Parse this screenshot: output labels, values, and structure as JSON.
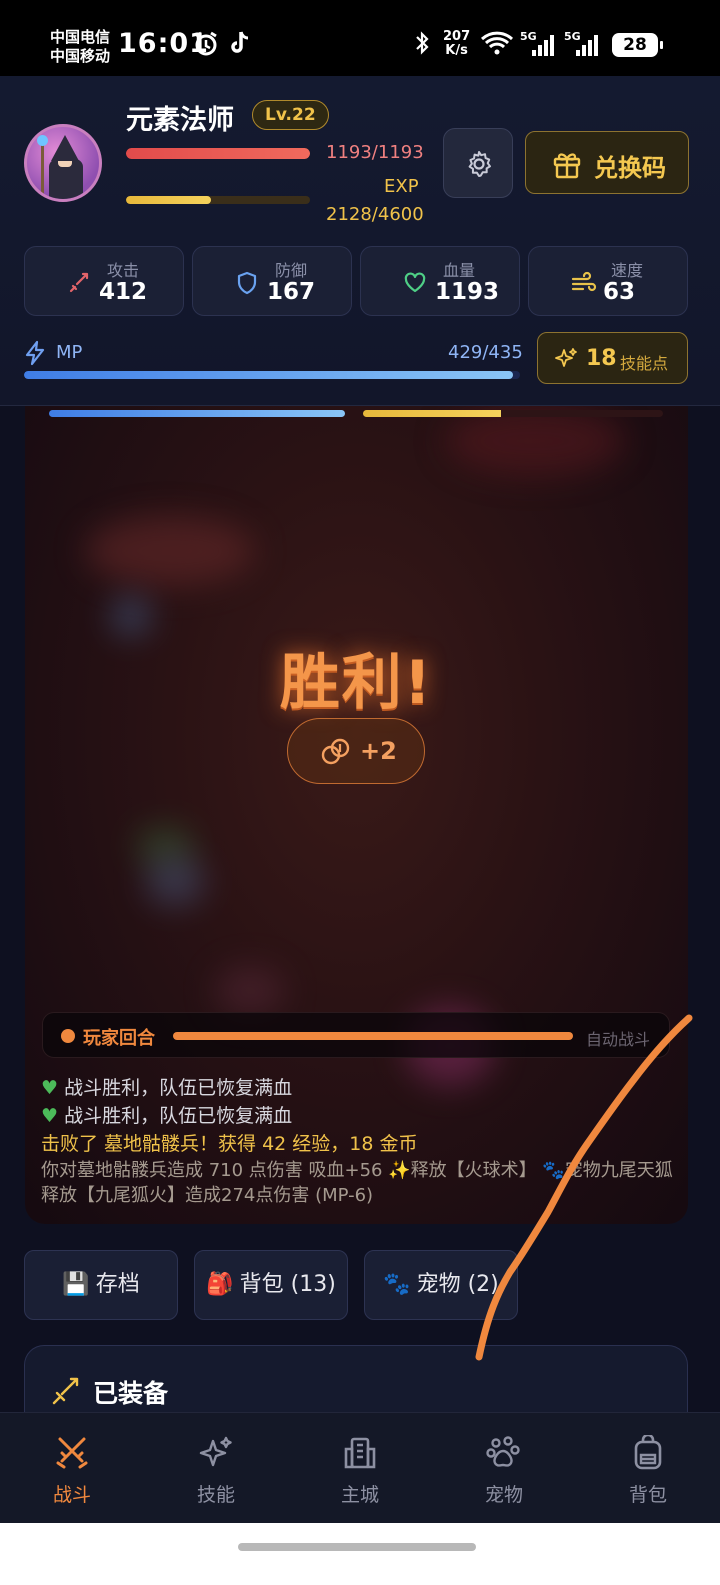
{
  "status_bar": {
    "carrier_1": "中国电信",
    "carrier_2": "中国移动",
    "time": "16:01",
    "net_speed_value": "207",
    "net_speed_unit": "K/s",
    "sim1_label": "5G",
    "sim2_label": "5G",
    "battery": "28"
  },
  "player": {
    "name": "元素法师",
    "level": "Lv.22",
    "hp_text": "1193/1193",
    "hp_ratio": 1.0,
    "exp_label": "EXP",
    "exp_text": "2128/4600",
    "exp_ratio": 0.4626,
    "avatar_icon": "wizard-avatar"
  },
  "buttons": {
    "settings_icon": "gear-icon",
    "redeem_label": "兑换码",
    "redeem_icon": "gift-icon"
  },
  "stats": [
    {
      "label": "攻击",
      "value": "412",
      "icon": "sword-icon",
      "color": "#e2646a"
    },
    {
      "label": "防御",
      "value": "167",
      "icon": "shield-icon",
      "color": "#6aa2f0"
    },
    {
      "label": "血量",
      "value": "1193",
      "icon": "heart-icon",
      "color": "#4fcf86"
    },
    {
      "label": "速度",
      "value": "63",
      "icon": "wind-icon",
      "color": "#e8c24a"
    }
  ],
  "mp": {
    "label": "MP",
    "text": "429/435",
    "ratio": 0.986
  },
  "skill_points": {
    "count": "18",
    "label": "技能点"
  },
  "battle": {
    "ally_mp_ratio": 1.0,
    "enemy_bar_ratio": 0.46,
    "victory_text": "胜利!",
    "reward_text": "+2",
    "reward_icon": "coins-icon",
    "turn_label": "玩家回合",
    "turn_progress": 1.0,
    "auto_label": "自动战斗"
  },
  "log": {
    "heal_1": "战斗胜利，队伍已恢复满血",
    "heal_2": "战斗胜利，队伍已恢复满血",
    "kill": "击败了 墓地骷髅兵！获得 42 经验，18 金币",
    "damage": "你对墓地骷髅兵造成 710 点伤害 吸血+56 ✨释放【火球术】 🐾宠物九尾天狐释放【九尾狐火】造成274点伤害 (MP-6)"
  },
  "actions": {
    "save_icon": "💾",
    "save_label": "存档",
    "bag_icon": "🎒",
    "bag_label": "背包 (13)",
    "pet_icon": "🐾",
    "pet_label": "宠物 (2)"
  },
  "equipment": {
    "title": "已装备",
    "icon": "sword-icon"
  },
  "nav": [
    {
      "label": "战斗",
      "icon": "crossed-swords-icon",
      "active": true
    },
    {
      "label": "技能",
      "icon": "sparkles-icon",
      "active": false
    },
    {
      "label": "主城",
      "icon": "building-icon",
      "active": false
    },
    {
      "label": "宠物",
      "icon": "paw-icon",
      "active": false
    },
    {
      "label": "背包",
      "icon": "backpack-icon",
      "active": false
    }
  ],
  "colors": {
    "accent": "#f0883e",
    "gold": "#f0c24a",
    "hp": "#e24b4b",
    "mp": "#5d9cf0",
    "annotation_stroke": "#f0883e"
  }
}
